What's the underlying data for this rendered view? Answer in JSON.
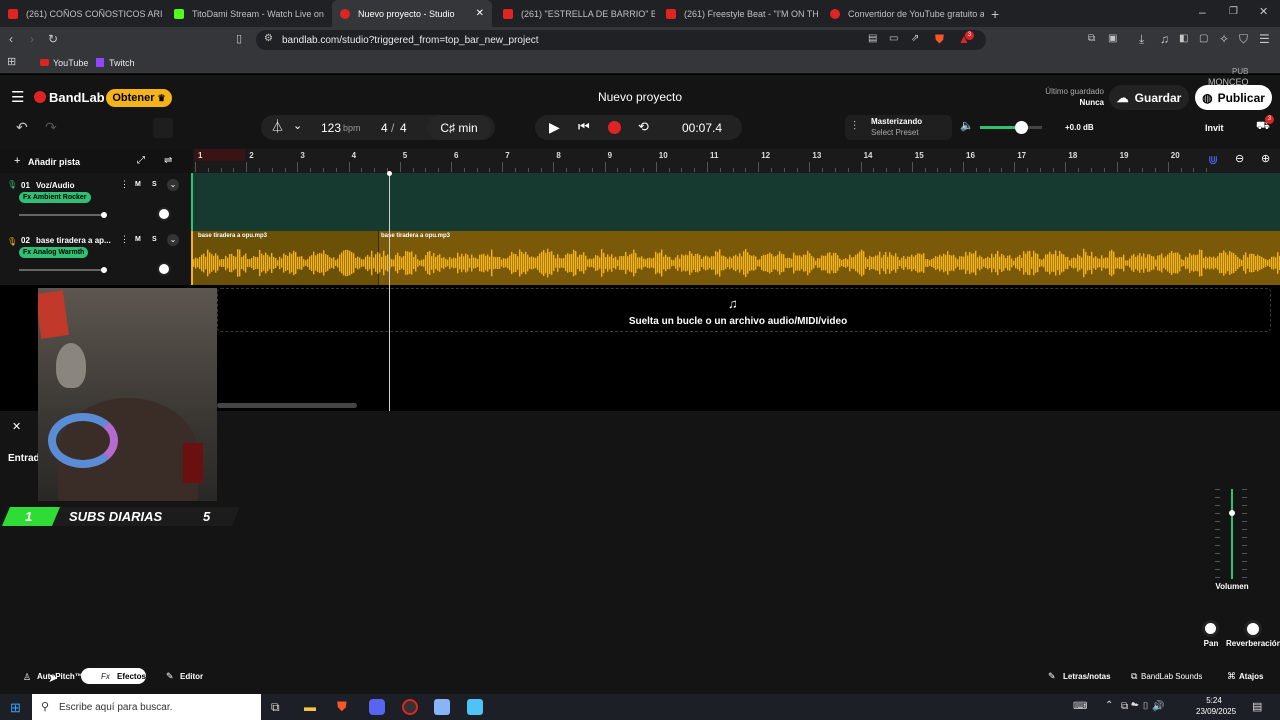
{
  "browser": {
    "tabs": [
      {
        "label": "(261) COÑOS COÑOSTICOS ARISTO",
        "active": false
      },
      {
        "label": "TitoDami Stream - Watch Live on Kick",
        "active": false
      },
      {
        "label": "Nuevo proyecto - Studio",
        "active": true
      },
      {
        "label": "(261) \"ESTRELLA DE BARRIO\" Base de",
        "active": false
      },
      {
        "label": "(261) Freestyle Beat - \"I'M ON THIS F",
        "active": false
      },
      {
        "label": "Convertidor de YouTube gratuito a M",
        "active": false
      }
    ],
    "url": "bandlab.com/studio?triggered_from=top_bar_new_project",
    "bookmarks": [
      "YouTube",
      "Twitch"
    ],
    "notif_count": "3"
  },
  "app": {
    "brand": "BandLab",
    "upgrade_label": "Obtener",
    "project_title": "Nuevo proyecto",
    "last_saved_label": "Último guardado",
    "last_saved_value": "Nunca",
    "save_label": "Guardar",
    "publish_label": "Publicar",
    "invite_label": "Invit",
    "cart_badge": "3",
    "overlay_text": "MONCEO",
    "overlay_text2": "PUB"
  },
  "transport": {
    "bpm": "123",
    "bpm_unit": "bpm",
    "time_sig_num": "4",
    "time_sig_sep": "/",
    "time_sig_den": "4",
    "key": "C♯ min",
    "time": "00:07.4",
    "mastering_label": "Masterizando",
    "mastering_preset": "Select Preset",
    "master_db": "+0.0 dB"
  },
  "timeline": {
    "add_track_label": "Añadir pista",
    "bars": [
      "1",
      "2",
      "3",
      "4",
      "5",
      "6",
      "7",
      "8",
      "9",
      "10",
      "11",
      "12",
      "13",
      "14",
      "15",
      "16",
      "17",
      "18",
      "19",
      "20"
    ],
    "tracks": [
      {
        "number": "01",
        "name": "Voz/Audio",
        "fx": "Fx Ambient Rocker",
        "mute": "M",
        "solo": "S"
      },
      {
        "number": "02",
        "name": "base tiradera a ap...",
        "fx": "Fx Analog Warmth",
        "mute": "M",
        "solo": "S"
      }
    ],
    "clips": [
      "base tiradera a opu.mp3",
      "base tiradera a opu.mp3"
    ],
    "drop_hint": "Suelta un bucle o un archivo audio/MIDI/video"
  },
  "lower_panel": {
    "input_label": "Entrad",
    "volume_label": "Volumen",
    "pan_label": "Pan",
    "reverb_label": "Reverberación",
    "subs_count": "1",
    "subs_label": "SUBS DIARIAS",
    "subs_goal": "5"
  },
  "bottombar": {
    "autopitch": "AutoPitch™",
    "effects": "Efectos",
    "editor": "Editor",
    "lyrics": "Letras/notas",
    "sounds": "BandLab Sounds",
    "shortcuts": "Atajos"
  },
  "taskbar": {
    "search_placeholder": "Escribe aquí para buscar.",
    "time": "5:24",
    "date": "23/09/2025"
  },
  "colors": {
    "accent_orange": "#f5b31a",
    "track_green": "#2fbf75",
    "record_red": "#e02424"
  }
}
